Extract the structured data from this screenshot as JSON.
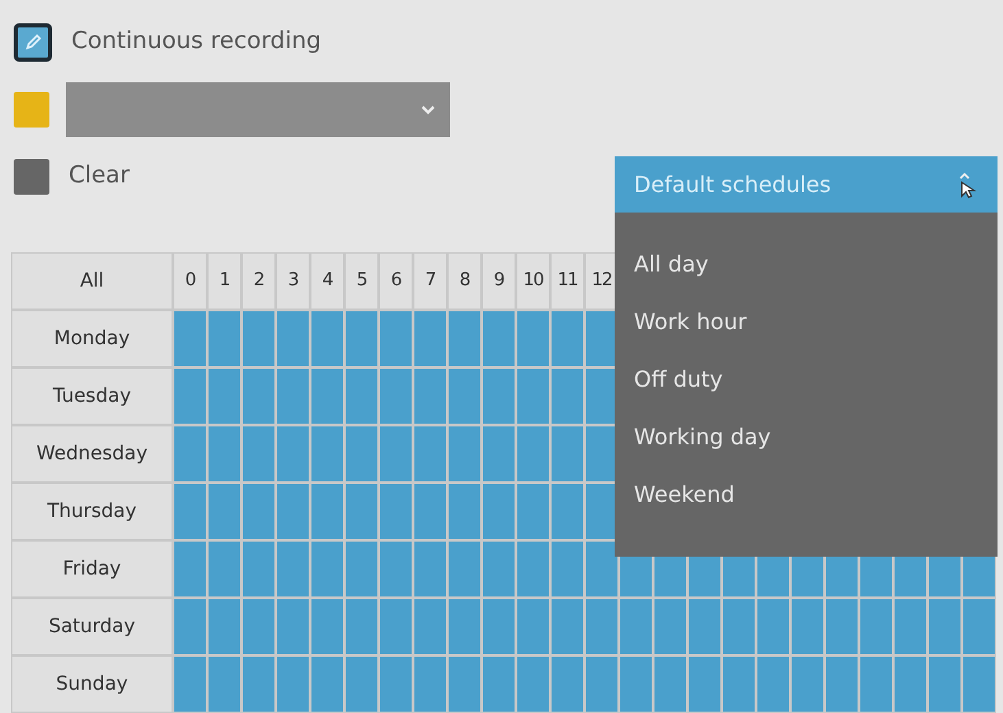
{
  "legend": [
    {
      "kind": "mode",
      "label": "Continuous recording"
    },
    {
      "kind": "select",
      "color": "#e6b417"
    },
    {
      "kind": "clear",
      "color": "#666666",
      "label": "Clear"
    }
  ],
  "schedule_grid": {
    "corner": "All",
    "hours": [
      "0",
      "1",
      "2",
      "3",
      "4",
      "5",
      "6",
      "7",
      "8",
      "9",
      "10",
      "11",
      "12"
    ],
    "days": [
      {
        "label": "Monday",
        "scheduled": true
      },
      {
        "label": "Tuesday",
        "scheduled": true
      },
      {
        "label": "Wednesday",
        "scheduled": true
      },
      {
        "label": "Thursday",
        "scheduled": true
      },
      {
        "label": "Friday",
        "scheduled": true
      },
      {
        "label": "Saturday",
        "scheduled": true
      },
      {
        "label": "Sunday",
        "scheduled": true
      }
    ]
  },
  "default_schedules": {
    "title": "Default schedules",
    "expanded": true,
    "options": [
      "All day",
      "Work hour",
      "Off duty",
      "Working day",
      "Weekend"
    ]
  }
}
